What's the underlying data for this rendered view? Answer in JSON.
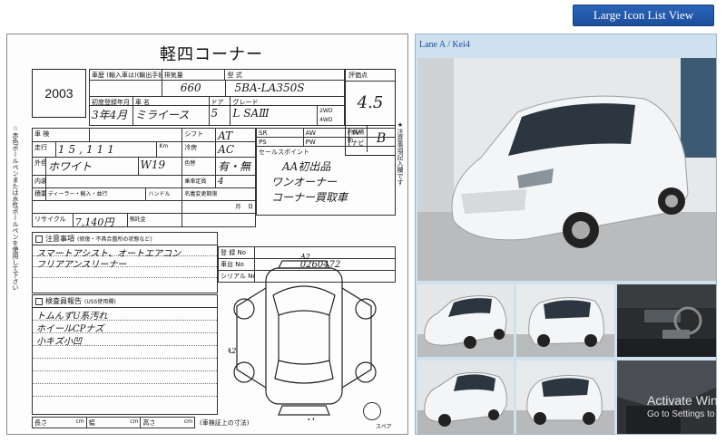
{
  "top_button": {
    "label": "Large Icon List View"
  },
  "sheet": {
    "title": "軽四コーナー",
    "year": "2003",
    "header_labels": {
      "car_history": "車歴",
      "car_history_note": "(輸入車は)(輸出手続)",
      "displacement": "排気量",
      "model": "型 式",
      "score": "評価点",
      "first_reg": "初度登録年月",
      "name": "車 名",
      "doors": "ドア",
      "grade": "グレード",
      "drive_2wd": "2WD",
      "drive_4wd": "4WD",
      "interior": "内装補助",
      "inspection": "車 検",
      "mileage": "走行",
      "km": "Km",
      "thousand": "千",
      "shift": "シフト",
      "aircon": "冷房",
      "color": "外色",
      "color_no": "色No.",
      "color_change": "色替",
      "interior_type": "内装",
      "seating": "乗車定員",
      "carrying": "積載量",
      "dealer": "ディーラー・輸入・並行",
      "handle": "ハンドル",
      "prev_use": "名義変更期限",
      "recycle": "リサイクル",
      "deposit": "預託金",
      "reg_no": "登 録 No",
      "chassis": "車台 No",
      "serial": "シリアル No",
      "notes": "注意事項",
      "notes_sub": "(修復・不具合箇所の状態など)",
      "inspector": "検査員報告",
      "inspector_sub": "(USS使用欄)",
      "length": "長さ",
      "width": "幅",
      "height": "高さ",
      "unit": "cm",
      "loading": "(車検証上の寸法)",
      "spare": "スペア",
      "side_note_left": "☆赤色ボールペンまたは水性ボールペンを使用して下さい",
      "side_note_right": "★注意事項記入欄です",
      "month": "月",
      "day": "日",
      "equipment": "セールスポイント",
      "opts": [
        "SR",
        "AW",
        "TV",
        "PS",
        "PW",
        "ナビ",
        "エア",
        "革",
        "エア"
      ]
    },
    "values": {
      "displacement": "660",
      "model": "5BA-LA350S",
      "first_reg": "3年4月",
      "name": "ミライース",
      "doors": "5",
      "grade": "L SAⅢ",
      "score": "4.5",
      "interior_score": "B",
      "mileage": "15,111",
      "shift": "AT",
      "aircon": "AC",
      "color": "ホワイト",
      "color_no": "W19",
      "color_change": "有・無",
      "seating": "4",
      "recycle": "7,140円",
      "chassis": "0260472",
      "sales_points": [
        "AA初出品",
        "ワンオーナー",
        "コーナー買取車"
      ],
      "notes_lines": [
        "スマートアシスト、オートエアコン",
        "フリアアンスリーナー"
      ],
      "inspector_lines": [
        "トムんずU系汚れ",
        "ホイールCPナズ",
        "小キズ小凹"
      ],
      "diagram_marks": [
        "A2",
        "UA2",
        "A1"
      ]
    }
  },
  "photos": {
    "lane_label": "Lane A / Kei4",
    "car_color": "#f4f5f6",
    "thumbnails": [
      "front-left",
      "rear-right",
      "interior-dashboard",
      "front-right",
      "rear-left",
      "interior-seat"
    ]
  },
  "watermark": {
    "line1": "Activate Win",
    "line2": "Go to Settings to"
  }
}
